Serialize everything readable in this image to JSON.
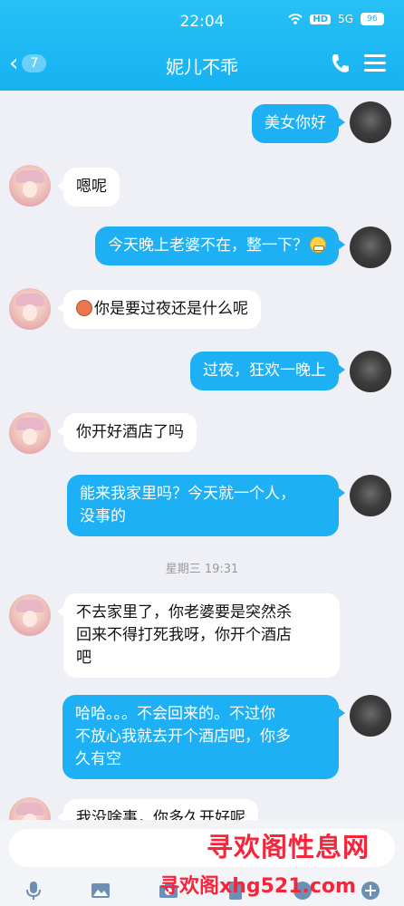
{
  "status_bar": {
    "time": "22:04",
    "network": "5G",
    "hd": "HD",
    "battery": "96"
  },
  "header": {
    "title": "妮儿不乖",
    "unread_count": "7"
  },
  "messages": [
    {
      "from": "me",
      "text": "美女你好"
    },
    {
      "from": "her",
      "text": "嗯呢"
    },
    {
      "from": "me",
      "text": "今天晚上老婆不在，整一下？",
      "emoji": "grin"
    },
    {
      "from": "her",
      "text": "你是要过夜还是什么呢",
      "emoji": "angry"
    },
    {
      "from": "me",
      "text": "过夜，狂欢一晚上"
    },
    {
      "from": "her",
      "text": "你开好酒店了吗"
    },
    {
      "from": "me",
      "lines": [
        "能来我家里吗？今天就一个人，",
        "没事的"
      ]
    },
    {
      "timestamp": "星期三 19:31"
    },
    {
      "from": "her",
      "lines": [
        "不去家里了，你老婆要是突然杀",
        "回来不得打死我呀，你开个酒店",
        "吧"
      ]
    },
    {
      "from": "me",
      "lines": [
        "哈哈。。。不会回来的。不过你",
        "不放心我就去开个酒店吧，你多",
        "久有空"
      ]
    },
    {
      "from": "her",
      "text": "我没啥事，你多久开好呢"
    }
  ],
  "toolbar": [
    "microphone-icon",
    "image-icon",
    "camera-icon",
    "red-packet-icon",
    "emoji-icon",
    "plus-icon"
  ],
  "watermark": {
    "line1": "寻欢阁性息网",
    "line2": "寻欢阁xhg521.com"
  },
  "colors": {
    "header": "#1eb4f3",
    "my_bubble": "#1eb0f4",
    "her_bubble": "#ffffff",
    "background": "#eef0f6",
    "watermark": "#f7243a"
  }
}
